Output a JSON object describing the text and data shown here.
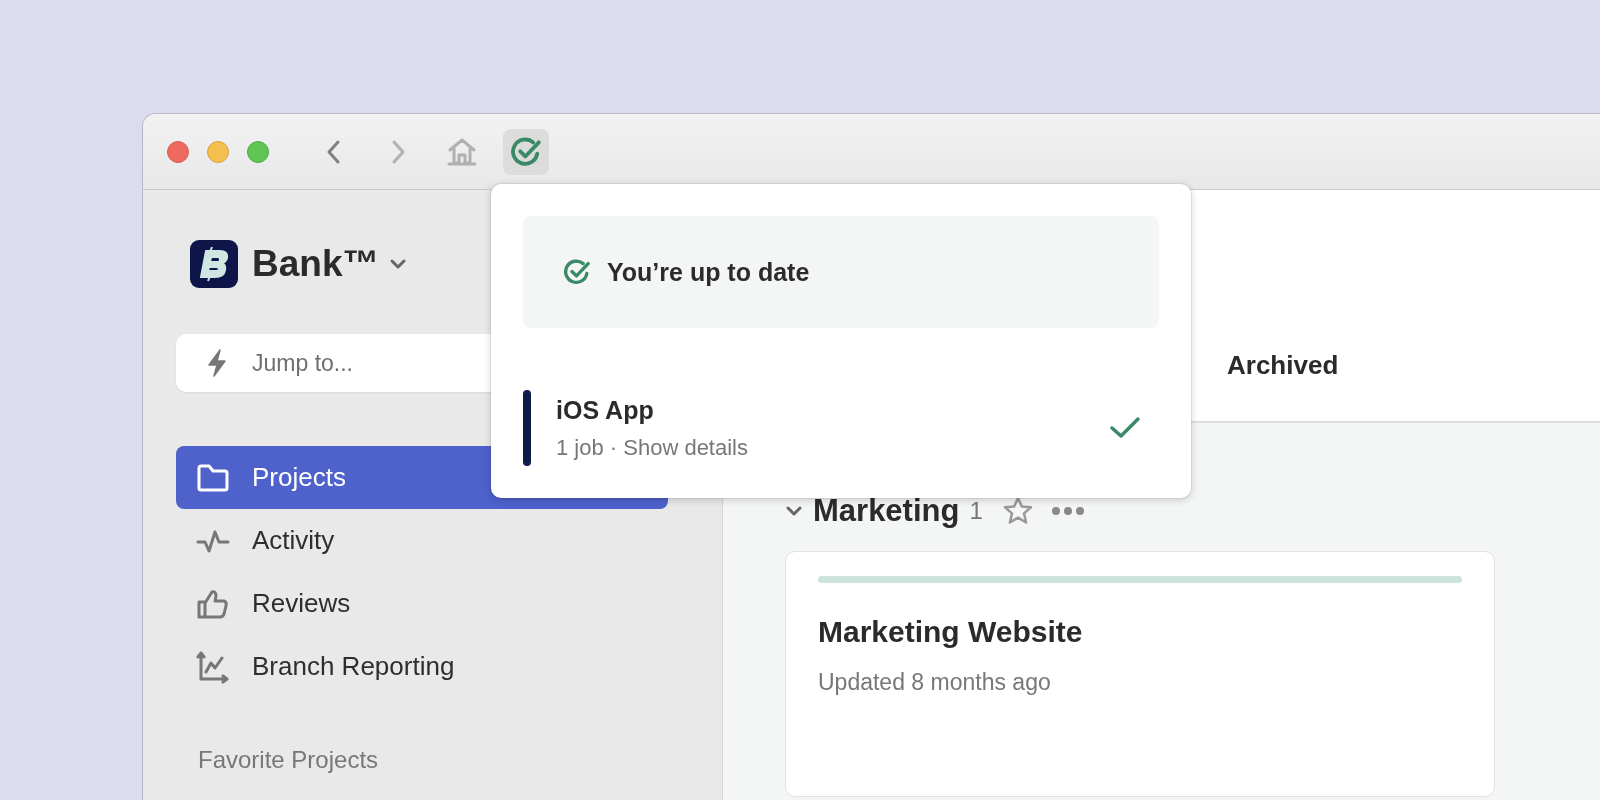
{
  "window": {
    "toolbar": [
      {
        "kind": "back",
        "pressed": false
      },
      {
        "kind": "forward",
        "pressed": false
      },
      {
        "kind": "home",
        "pressed": false
      },
      {
        "kind": "status",
        "pressed": true
      }
    ]
  },
  "sidebar": {
    "workspace": "Bank™",
    "search": {
      "placeholder": "Jump to..."
    },
    "items": [
      {
        "label": "Projects",
        "kind": "folder",
        "selected": true
      },
      {
        "label": "Activity",
        "kind": "pulse",
        "selected": false
      },
      {
        "label": "Reviews",
        "kind": "thumb",
        "selected": false
      },
      {
        "label": "Branch Reporting",
        "kind": "chart",
        "selected": false
      }
    ],
    "section_heading": "Favorite Projects"
  },
  "main": {
    "tabs": [
      {
        "label": "Archived",
        "selected": false
      }
    ],
    "groups": [
      {
        "name": "Marketing",
        "count": "1",
        "starred": false,
        "expanded": true,
        "projects": [
          {
            "title": "Marketing Website",
            "updated": "Updated 8 months ago",
            "color": "#cde3de"
          }
        ]
      }
    ]
  },
  "popup": {
    "status": "You’re up to date",
    "apps": [
      {
        "name": "iOS App",
        "detail": "1 job · Show details",
        "color": "#0e1a4a",
        "done": true
      }
    ]
  }
}
